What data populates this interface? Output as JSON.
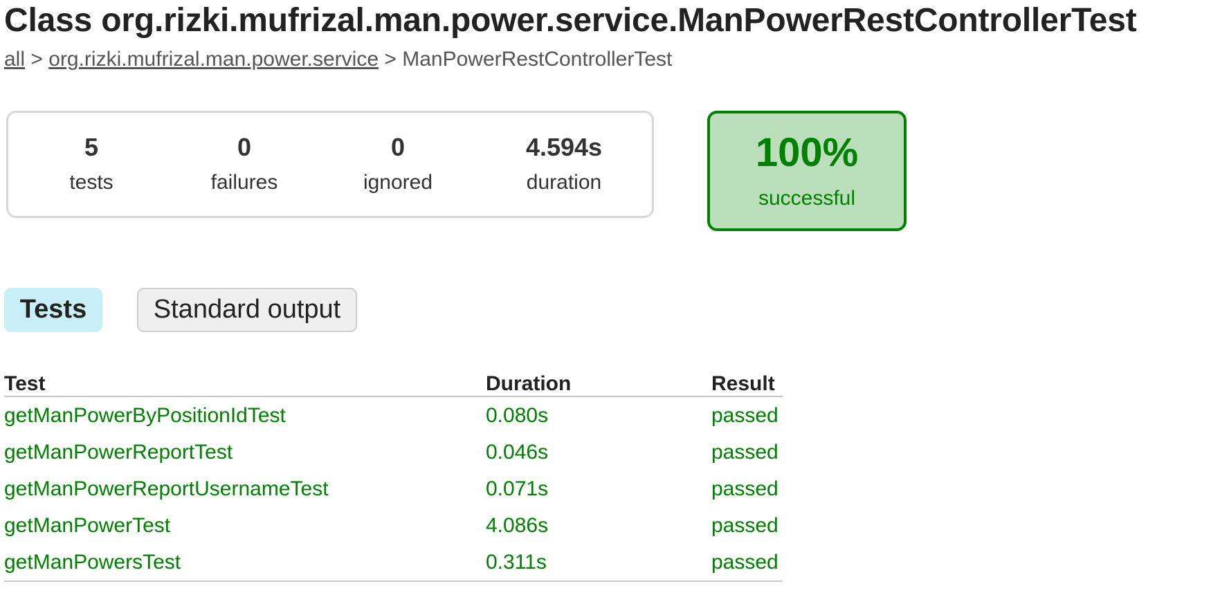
{
  "header": {
    "title": "Class org.rizki.mufrizal.man.power.service.ManPowerRestControllerTest"
  },
  "breadcrumb": {
    "all_label": "all",
    "separator_1": " > ",
    "package_label": "org.rizki.mufrizal.man.power.service",
    "separator_2": " > ",
    "current_label": "ManPowerRestControllerTest"
  },
  "summary": {
    "tests": {
      "value": "5",
      "label": "tests"
    },
    "failures": {
      "value": "0",
      "label": "failures"
    },
    "ignored": {
      "value": "0",
      "label": "ignored"
    },
    "duration": {
      "value": "4.594s",
      "label": "duration"
    },
    "success": {
      "value": "100%",
      "label": "successful"
    }
  },
  "tabs": [
    {
      "label": "Tests",
      "active": true
    },
    {
      "label": "Standard output",
      "active": false
    }
  ],
  "table": {
    "headers": {
      "test": "Test",
      "duration": "Duration",
      "result": "Result"
    },
    "rows": [
      {
        "test": "getManPowerByPositionIdTest",
        "duration": "0.080s",
        "result": "passed"
      },
      {
        "test": "getManPowerReportTest",
        "duration": "0.046s",
        "result": "passed"
      },
      {
        "test": "getManPowerReportUsernameTest",
        "duration": "0.071s",
        "result": "passed"
      },
      {
        "test": "getManPowerTest",
        "duration": "4.086s",
        "result": "passed"
      },
      {
        "test": "getManPowersTest",
        "duration": "0.311s",
        "result": "passed"
      }
    ]
  },
  "colors": {
    "success_green": "#008000",
    "success_bg": "#bbdebb",
    "active_tab_bg": "#c8eff5"
  }
}
